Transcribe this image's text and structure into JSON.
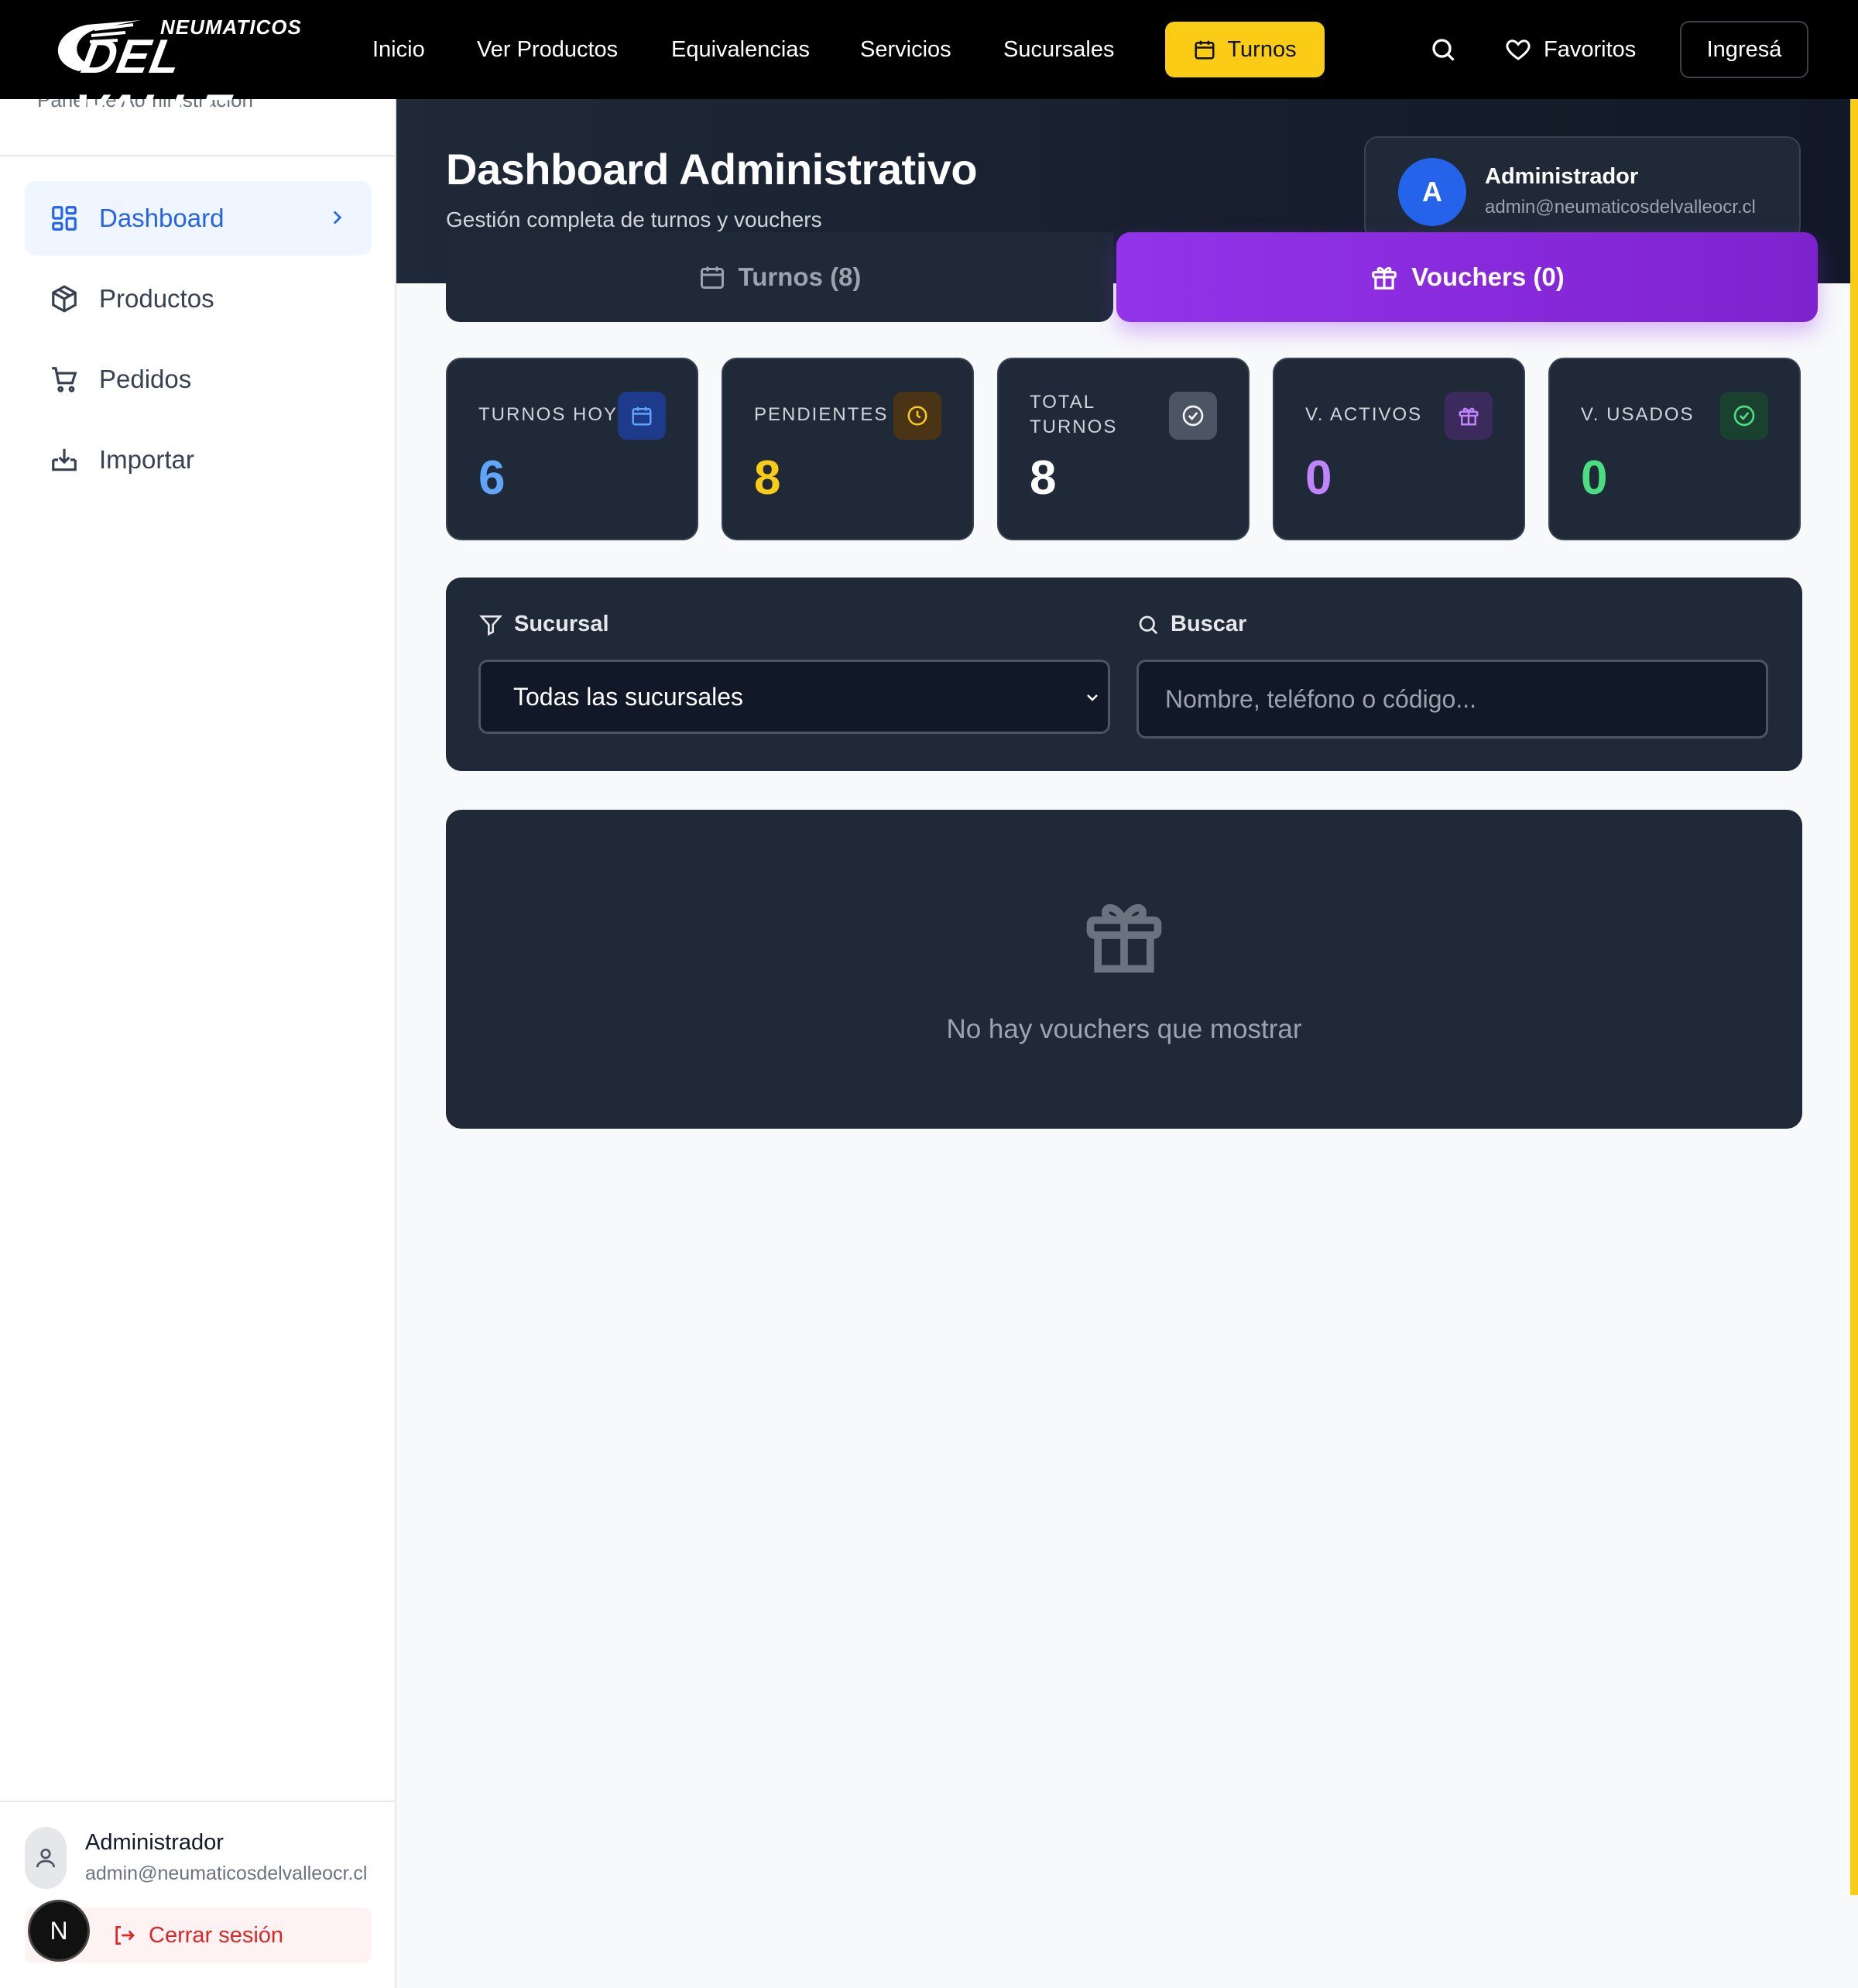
{
  "brand": {
    "line1": "NEUMATICOS",
    "line2": "DEL VALLE"
  },
  "nav": {
    "links": [
      "Inicio",
      "Ver Productos",
      "Equivalencias",
      "Servicios",
      "Sucursales"
    ],
    "turnos_label": "Turnos",
    "favoritos_label": "Favoritos",
    "login_label": "Ingresá"
  },
  "sidebar": {
    "subtitle": "Panel de Administración",
    "items": [
      {
        "label": "Dashboard",
        "icon": "dashboard-icon",
        "active": true
      },
      {
        "label": "Productos",
        "icon": "package-icon"
      },
      {
        "label": "Pedidos",
        "icon": "cart-icon"
      },
      {
        "label": "Importar",
        "icon": "import-icon"
      }
    ],
    "user": {
      "name": "Administrador",
      "email": "admin@neumaticosdelvalleocr.cl"
    },
    "logout_label": "Cerrar sesión",
    "badge_letter": "N"
  },
  "header": {
    "title": "Dashboard Administrativo",
    "subtitle": "Gestión completa de turnos y vouchers",
    "admin": {
      "initial": "A",
      "name": "Administrador",
      "email": "admin@neumaticosdelvalleocr.cl"
    }
  },
  "tabs": {
    "turnos": "Turnos (8)",
    "vouchers": "Vouchers (0)",
    "active": "vouchers"
  },
  "stats": [
    {
      "label": "TURNOS HOY",
      "value": "6",
      "color": "#60a5fa",
      "icon": "calendar-icon"
    },
    {
      "label": "PENDIENTES",
      "value": "8",
      "color": "#facc15",
      "icon": "clock-icon"
    },
    {
      "label_line1": "TOTAL",
      "label_line2": "TURNOS",
      "value": "8",
      "color": "#ffffff",
      "icon": "check-circle-icon"
    },
    {
      "label": "V. ACTIVOS",
      "value": "0",
      "color": "#c084fc",
      "icon": "gift-icon"
    },
    {
      "label": "V. USADOS",
      "value": "0",
      "color": "#4ade80",
      "icon": "check-circle-icon"
    }
  ],
  "filters": {
    "sucursal_label": "Sucursal",
    "sucursal_value": "Todas las sucursales",
    "buscar_label": "Buscar",
    "buscar_placeholder": "Nombre, teléfono o código..."
  },
  "empty_state": {
    "text": "No hay vouchers que mostrar"
  },
  "colors": {
    "accent_yellow": "#facc15",
    "accent_purple": "#9333ea",
    "panel_dark": "#1f2937"
  }
}
